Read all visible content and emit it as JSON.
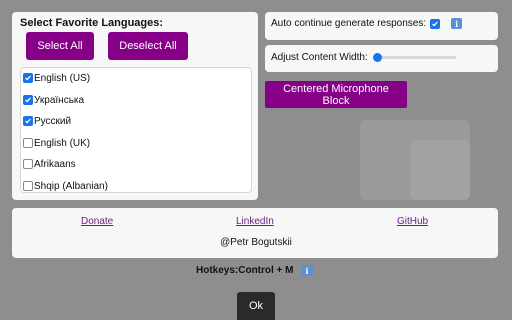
{
  "languages_section": {
    "title": "Select Favorite Languages:",
    "select_all_label": "Select All",
    "deselect_all_label": "Deselect All",
    "items": [
      {
        "label": "English (US)",
        "checked": true
      },
      {
        "label": "Українська",
        "checked": true
      },
      {
        "label": "Русский",
        "checked": true
      },
      {
        "label": "English (UK)",
        "checked": false
      },
      {
        "label": "Afrikaans",
        "checked": false
      },
      {
        "label": "Shqip (Albanian)",
        "checked": false
      }
    ]
  },
  "settings": {
    "auto_continue_label": "Auto continue generate responses:",
    "auto_continue_checked": true,
    "adjust_width_label": "Adjust Content Width:",
    "width_value": 0,
    "centered_mic_label": "Centered Microphone Block"
  },
  "footer": {
    "donate_label": "Donate",
    "linkedin_label": "LinkedIn",
    "github_label": "GitHub",
    "author": "@Petr Bogutskii"
  },
  "hotkeys_label": "Hotkeys:Control + M",
  "ok_label": "Ok",
  "colors": {
    "accent": "#850087",
    "checkbox": "#1a73e8",
    "backdrop": "#8e8e8e"
  },
  "icons": {
    "info": "info-icon",
    "check": "check-icon"
  }
}
